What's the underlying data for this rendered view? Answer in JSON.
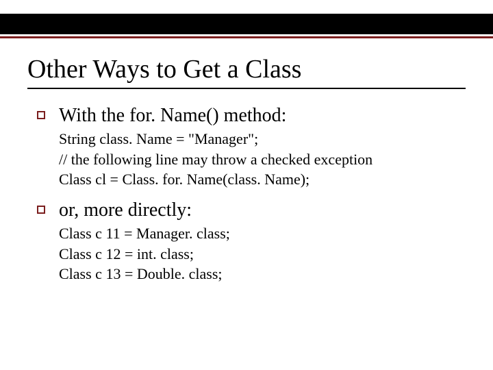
{
  "title": "Other Ways to Get a Class",
  "bullets": [
    {
      "head": "With the for. Name() method:",
      "sub": [
        "String class. Name = \"Manager\";",
        "// the following line may throw a checked exception",
        "Class cl = Class. for. Name(class. Name);"
      ]
    },
    {
      "head": "or, more directly:",
      "sub": [
        "Class c 11 = Manager. class;",
        "Class c 12 = int. class;",
        "Class c 13 = Double. class;"
      ]
    }
  ]
}
